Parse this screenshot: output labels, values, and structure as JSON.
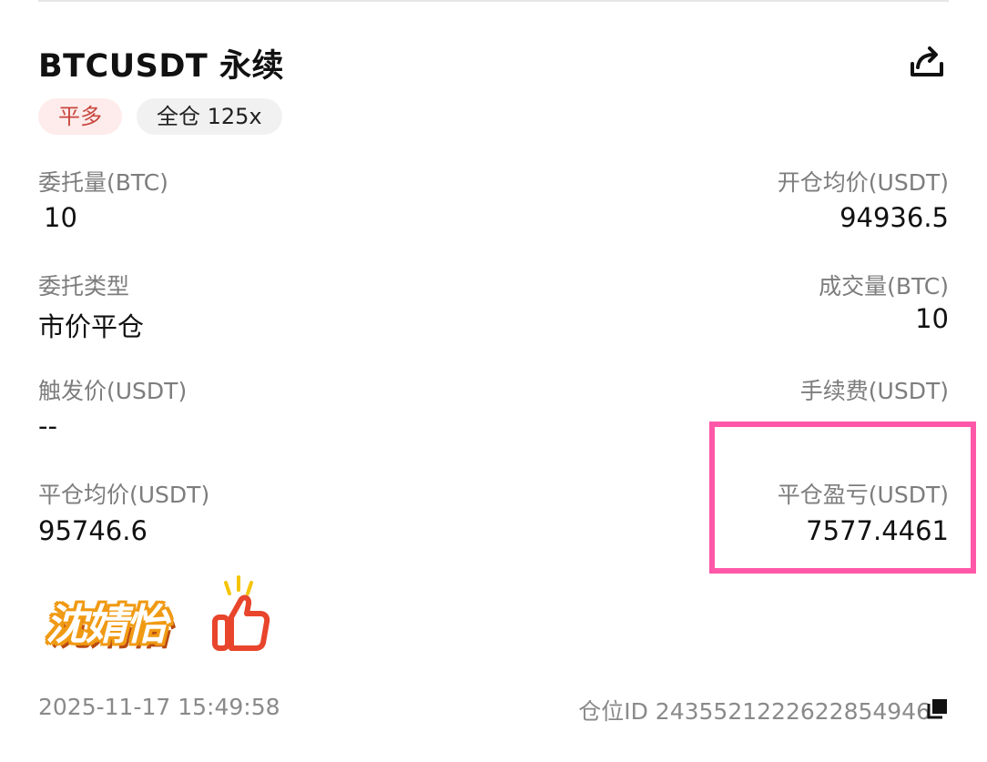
{
  "header": {
    "title": "BTCUSDT 永续",
    "share_icon": "share-icon"
  },
  "tags": {
    "side": "平多",
    "mode": "全仓 125x"
  },
  "fields": {
    "order_qty": {
      "label": "委托量(BTC)",
      "value": "10"
    },
    "avg_open": {
      "label": "开仓均价(USDT)",
      "value": "94936.5"
    },
    "order_type": {
      "label": "委托类型",
      "value": "市价平仓"
    },
    "filled_qty": {
      "label": "成交量(BTC)",
      "value": "10"
    },
    "trigger_price": {
      "label": "触发价(USDT)",
      "value": "--"
    },
    "fee": {
      "label": "手续费(USDT)"
    },
    "avg_close": {
      "label": "平仓均价(USDT)",
      "value": "95746.6"
    },
    "close_pnl": {
      "label": "平仓盈亏(USDT)",
      "value": "7577.4461"
    }
  },
  "sticker": {
    "text": "沈婧怡",
    "icon": "thumbs-up-icon"
  },
  "footer": {
    "timestamp": "2025-11-17 15:49:58",
    "position_id": "仓位ID 2435521222622854946",
    "copy_icon": "copy-icon"
  },
  "colors": {
    "highlight": "#ff58a8",
    "tag_side_bg": "#fdeceb",
    "tag_side_text": "#c8473f",
    "sticker_fill": "#f09a14",
    "thumb_red": "#e8452c"
  }
}
